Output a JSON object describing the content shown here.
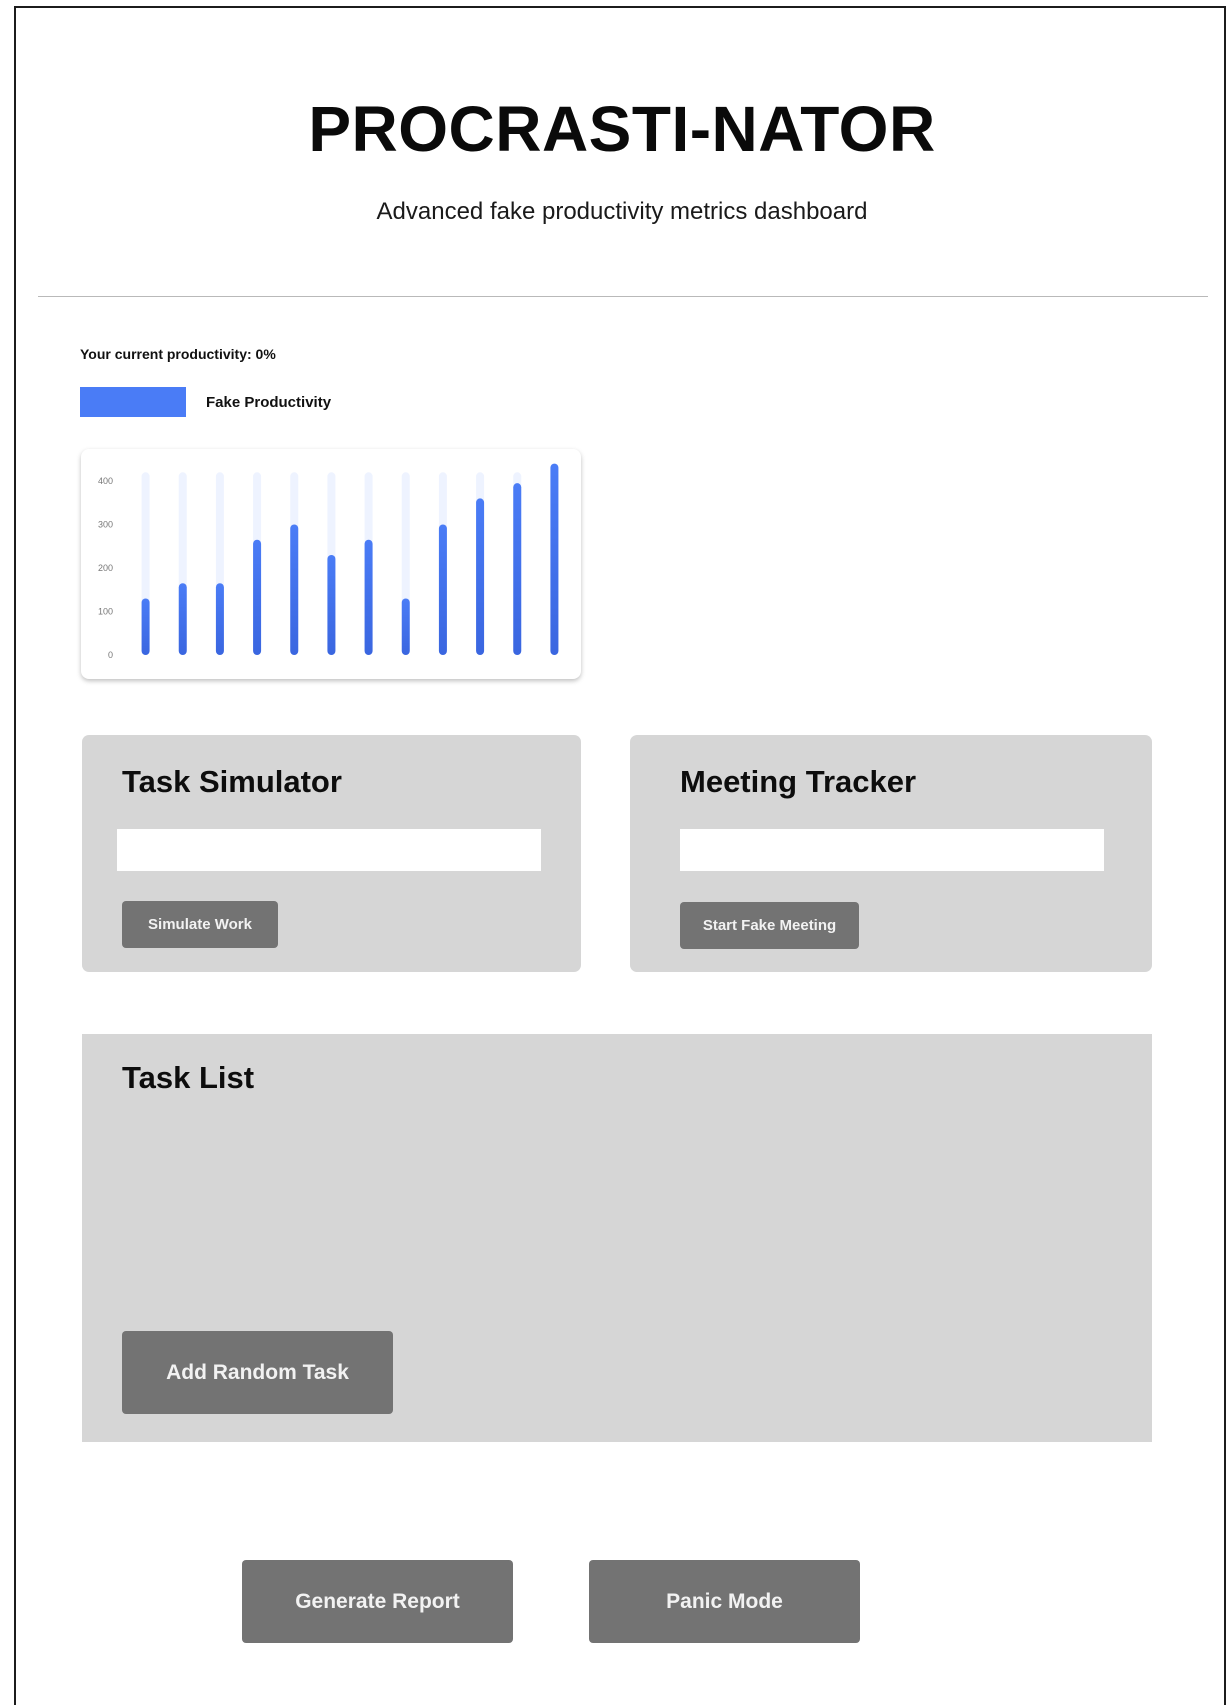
{
  "header": {
    "title": "PROCRASTI-NATOR",
    "subtitle": "Advanced fake productivity metrics dashboard"
  },
  "productivity": {
    "label": "Your current productivity: 0%",
    "value_percent": 0
  },
  "legend": {
    "label": "Fake Productivity",
    "color": "#4a7cf6"
  },
  "chart_data": {
    "type": "bar",
    "categories": [
      "",
      "",
      "",
      "",
      "",
      "",
      "",
      "",
      "",
      "",
      "",
      ""
    ],
    "series": [
      {
        "name": "Fake Productivity",
        "values": [
          130,
          165,
          165,
          265,
          300,
          230,
          265,
          130,
          300,
          360,
          395,
          440
        ]
      }
    ],
    "ylim": [
      0,
      400
    ],
    "yticks": [
      "0",
      "100",
      "200",
      "300",
      "400"
    ],
    "background_track_max": 420,
    "grid": false,
    "bar_color": "#4a7cf6",
    "track_color": "#eef3ff"
  },
  "task_simulator": {
    "title": "Task Simulator",
    "input_value": "",
    "input_placeholder": "",
    "button_label": "Simulate Work"
  },
  "meeting_tracker": {
    "title": "Meeting Tracker",
    "input_value": "",
    "input_placeholder": "",
    "button_label": "Start Fake Meeting"
  },
  "task_list": {
    "title": "Task List",
    "items": [],
    "add_button_label": "Add Random Task"
  },
  "footer": {
    "generate_report_label": "Generate Report",
    "panic_mode_label": "Panic Mode"
  },
  "colors": {
    "card_background": "#d6d6d6",
    "button_background": "#737373",
    "accent": "#4a7cf6"
  }
}
